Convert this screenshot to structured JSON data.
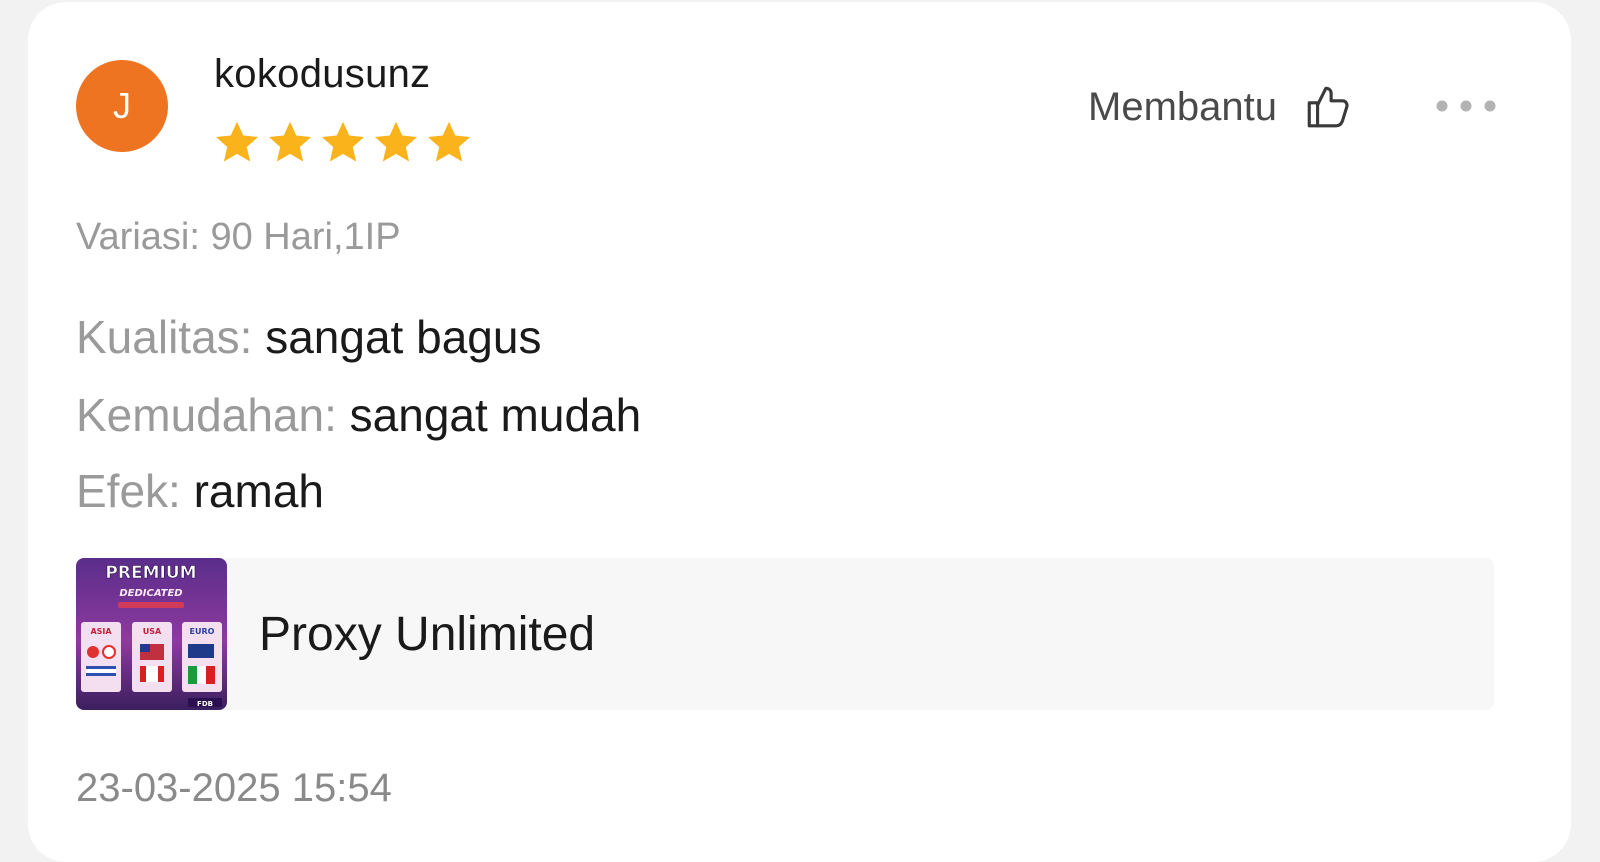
{
  "review": {
    "avatar_initial": "J",
    "avatar_color": "#ee7422",
    "username": "kokodusunz",
    "rating": 5,
    "star_color": "#fbb31b",
    "helpful_label": "Membantu",
    "helpful_icon": "thumbs-up-icon",
    "more_icon": "more-horizontal-icon",
    "variation": "Variasi: 90 Hari,1IP",
    "attributes": [
      {
        "label": "Kualitas:",
        "value": "sangat bagus"
      },
      {
        "label": "Kemudahan:",
        "value": "sangat mudah"
      },
      {
        "label": "Efek:",
        "value": "ramah"
      }
    ],
    "product": {
      "name": "Proxy Unlimited",
      "thumb_badge": "PREMIUM",
      "thumb_subtitle": "DEDICATED",
      "thumb_columns": [
        "ASIA",
        "USA",
        "EURO"
      ],
      "thumb_footer": "FDB"
    },
    "timestamp": "23-03-2025 15:54"
  }
}
